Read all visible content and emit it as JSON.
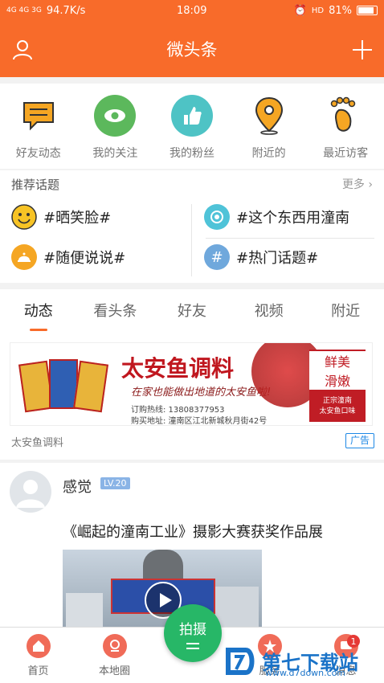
{
  "status_bar": {
    "network": "4G 4G 3G",
    "speed": "94.7K/s",
    "time": "18:09",
    "volte": "HD",
    "battery": "81%"
  },
  "header": {
    "title": "微头条",
    "left_icon": "user-icon",
    "right_icon": "plus-icon"
  },
  "quick_actions": [
    {
      "label": "好友动态",
      "icon": "chat-bubble-icon",
      "color": "#f5a623"
    },
    {
      "label": "我的关注",
      "icon": "eye-icon",
      "color": "#5cb85c"
    },
    {
      "label": "我的粉丝",
      "icon": "thumb-up-icon",
      "color": "#4ec3c5"
    },
    {
      "label": "附近的",
      "icon": "location-pin-icon",
      "color": "#f5a623"
    },
    {
      "label": "最近访客",
      "icon": "footprint-icon",
      "color": "#f5a623"
    }
  ],
  "topics": {
    "header": "推荐话题",
    "more": "更多",
    "items": [
      {
        "label": "#晒笑脸#",
        "icon": "smile-icon",
        "color": "#f7c325"
      },
      {
        "label": "#这个东西用潼南",
        "icon": "camera-icon",
        "color": "#4fc3d8"
      },
      {
        "label": "#随便说说#",
        "icon": "tray-icon",
        "color": "#f5a623"
      },
      {
        "label": "#热门话题#",
        "icon": "hashtag-icon",
        "color": "#6fa8dc"
      }
    ]
  },
  "tabs": [
    {
      "label": "动态",
      "active": true
    },
    {
      "label": "看头条",
      "active": false
    },
    {
      "label": "好友",
      "active": false
    },
    {
      "label": "视频",
      "active": false
    },
    {
      "label": "附近",
      "active": false
    }
  ],
  "ad": {
    "banner_title": "太安鱼调料",
    "banner_slogan": "在家也能做出地道的太安鱼啦!",
    "hotline": "订购热线: 13808377953",
    "address": "购买地址: 潼南区江北新城秋月街42号",
    "stamp_top": "鲜美",
    "stamp_mid": "滑嫩",
    "stamp_sub1": "正宗潼南",
    "stamp_sub2": "太安鱼口味",
    "label": "太安鱼调料",
    "badge": "广告"
  },
  "post": {
    "author": "感觉",
    "level": "LV.20",
    "title": "《崛起的潼南工业》摄影大赛获奖作品展"
  },
  "bottom_nav": [
    {
      "label": "首页",
      "icon": "home-icon"
    },
    {
      "label": "本地圈",
      "icon": "location-icon"
    },
    {
      "label": "服务",
      "icon": "star-icon"
    },
    {
      "label": "消息",
      "icon": "message-icon"
    }
  ],
  "shoot_button": "拍摄",
  "notification_count": "1",
  "watermark": {
    "main": "第七下载站",
    "sub": "www.d7down.com"
  }
}
